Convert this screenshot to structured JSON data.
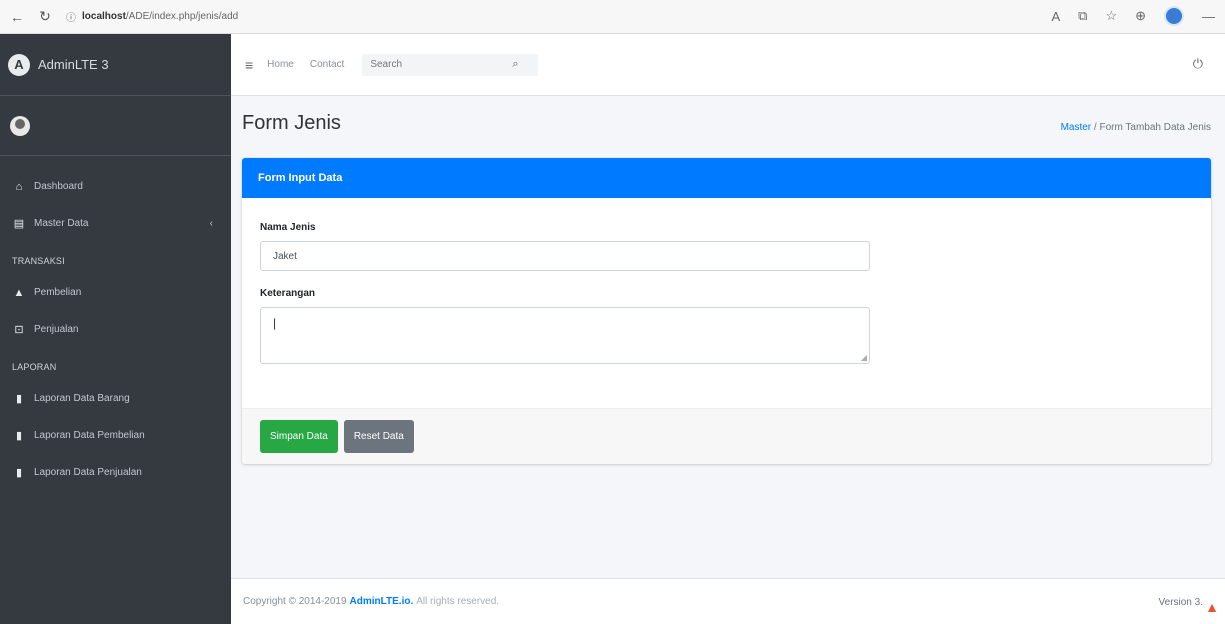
{
  "browser": {
    "url_host": "localhost",
    "url_path": "/ADE/index.php/jenis/add"
  },
  "sidebar": {
    "brand": "AdminLTE 3",
    "items": [
      {
        "label": "Dashboard",
        "icon": "home-icon"
      },
      {
        "label": "Master Data",
        "icon": "database-icon"
      }
    ],
    "section_transaksi": "TRANSAKSI",
    "transaksi_items": [
      {
        "label": "Pembelian",
        "icon": "shopping-bag-icon"
      },
      {
        "label": "Penjualan",
        "icon": "cart-icon"
      }
    ],
    "section_laporan": "LAPORAN",
    "laporan_items": [
      {
        "label": "Laporan Data Barang",
        "icon": "file-icon"
      },
      {
        "label": "Laporan Data Pembelian",
        "icon": "file-icon"
      },
      {
        "label": "Laporan Data Penjualan",
        "icon": "file-icon"
      }
    ]
  },
  "navbar": {
    "home": "Home",
    "contact": "Contact",
    "search_placeholder": "Search"
  },
  "page": {
    "title": "Form Jenis",
    "breadcrumb_link": "Master",
    "breadcrumb_current": "Form Tambah Data Jenis"
  },
  "form": {
    "header": "Form Input Data",
    "nama_label": "Nama Jenis",
    "nama_value": "Jaket",
    "ket_label": "Keterangan",
    "ket_value": "",
    "save_label": "Simpan Data",
    "reset_label": "Reset Data"
  },
  "footer": {
    "copyright": "Copyright © 2014-2019",
    "brand": "AdminLTE.io.",
    "rights": "All rights reserved.",
    "version": "Version 3."
  },
  "colors": {
    "primary": "#007bff",
    "success": "#28a745",
    "secondary": "#6c757d",
    "sidebar": "#343a40"
  }
}
